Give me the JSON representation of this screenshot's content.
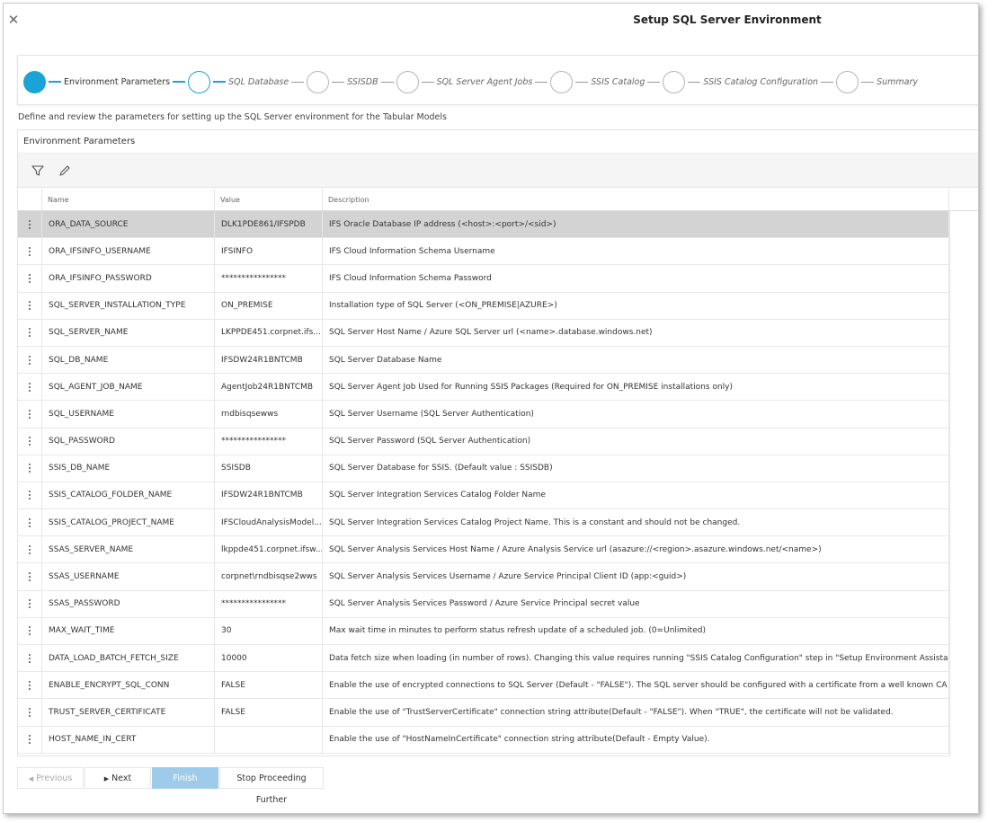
{
  "dialog": {
    "title": "Setup SQL Server Environment",
    "close_icon": "close-icon"
  },
  "stepper": {
    "steps": [
      {
        "label": "Environment Parameters",
        "state": "active"
      },
      {
        "label": "SQL Database",
        "state": "current"
      },
      {
        "label": "SSISDB",
        "state": "pending"
      },
      {
        "label": "SQL Server Agent Jobs",
        "state": "pending"
      },
      {
        "label": "SSIS Catalog",
        "state": "pending"
      },
      {
        "label": "SSIS Catalog Configuration",
        "state": "pending"
      },
      {
        "label": "Summary",
        "state": "pending"
      }
    ]
  },
  "description": "Define and review the parameters for setting up the SQL Server environment for the Tabular Models",
  "panel": {
    "title": "Environment Parameters",
    "toolbar": {
      "filter_icon": "filter-icon",
      "edit_icon": "pencil-icon"
    },
    "columns": {
      "name": "Name",
      "value": "Value",
      "description": "Description"
    },
    "rows": [
      {
        "name": "ORA_DATA_SOURCE",
        "value": "DLK1PDE861/IFSPDB",
        "description": "IFS Oracle Database IP address (<host>:<port>/<sid>)",
        "selected": true
      },
      {
        "name": "ORA_IFSINFO_USERNAME",
        "value": "IFSINFO",
        "description": "IFS Cloud Information Schema Username"
      },
      {
        "name": "ORA_IFSINFO_PASSWORD",
        "value": "****************",
        "description": "IFS Cloud Information Schema Password"
      },
      {
        "name": "SQL_SERVER_INSTALLATION_TYPE",
        "value": "ON_PREMISE",
        "description": "Installation type of SQL Server (<ON_PREMISE|AZURE>)"
      },
      {
        "name": "SQL_SERVER_NAME",
        "value": "LKPPDE451.corpnet.ifs...",
        "description": "SQL Server Host Name / Azure SQL Server url (<name>.database.windows.net)"
      },
      {
        "name": "SQL_DB_NAME",
        "value": "IFSDW24R1BNTCMB",
        "description": "SQL Server Database Name"
      },
      {
        "name": "SQL_AGENT_JOB_NAME",
        "value": "AgentJob24R1BNTCMB",
        "description": "SQL Server Agent Job Used for Running SSIS Packages (Required for ON_PREMISE installations only)"
      },
      {
        "name": "SQL_USERNAME",
        "value": "rndbisqsewws",
        "description": "SQL Server Username (SQL Server Authentication)"
      },
      {
        "name": "SQL_PASSWORD",
        "value": "****************",
        "description": "SQL Server Password (SQL Server Authentication)"
      },
      {
        "name": "SSIS_DB_NAME",
        "value": "SSISDB",
        "description": "SQL Server Database for SSIS. (Default value : SSISDB)"
      },
      {
        "name": "SSIS_CATALOG_FOLDER_NAME",
        "value": "IFSDW24R1BNTCMB",
        "description": "SQL Server Integration Services Catalog Folder Name"
      },
      {
        "name": "SSIS_CATALOG_PROJECT_NAME",
        "value": "IFSCloudAnalysisModel...",
        "description": "SQL Server Integration Services Catalog Project Name. This is a constant and should not be changed."
      },
      {
        "name": "SSAS_SERVER_NAME",
        "value": "lkppde451.corpnet.ifsw...",
        "description": "SQL Server Analysis Services Host Name / Azure Analysis Service url (asazure://<region>.asazure.windows.net/<name>)"
      },
      {
        "name": "SSAS_USERNAME",
        "value": "corpnet\\rndbisqse2wws",
        "description": "SQL Server Analysis Services Username / Azure Service Principal Client ID (app:<guid>)"
      },
      {
        "name": "SSAS_PASSWORD",
        "value": "****************",
        "description": "SQL Server Analysis Services Password / Azure Service Principal secret value"
      },
      {
        "name": "MAX_WAIT_TIME",
        "value": "30",
        "description": "Max wait time in minutes to perform status refresh update of a scheduled job. (0=Unlimited)"
      },
      {
        "name": "DATA_LOAD_BATCH_FETCH_SIZE",
        "value": "10000",
        "description": "Data fetch size when loading (in number of rows). Changing this value requires running \"SSIS Catalog Configuration\" step in \"Setup Environment Assistant\""
      },
      {
        "name": "ENABLE_ENCRYPT_SQL_CONN",
        "value": "FALSE",
        "description": "Enable the use of encrypted connections to SQL Server (Default - \"FALSE\"). The SQL server should be configured with a certificate from a well known CA"
      },
      {
        "name": "TRUST_SERVER_CERTIFICATE",
        "value": "FALSE",
        "description": "Enable the use of \"TrustServerCertificate\" connection string attribute(Default - \"FALSE\"). When \"TRUE\", the certificate will not be validated."
      },
      {
        "name": "HOST_NAME_IN_CERT",
        "value": "",
        "description": "Enable the use of \"HostNameInCertificate\" connection string attribute(Default - Empty Value)."
      }
    ]
  },
  "footer": {
    "previous": "Previous",
    "next": "Next",
    "finish": "Finish",
    "stop": "Stop Proceeding Further"
  },
  "colors": {
    "accent": "#1aa3d4",
    "finish_disabled": "#9fcbeb",
    "selected_row": "#d3d3d3"
  }
}
